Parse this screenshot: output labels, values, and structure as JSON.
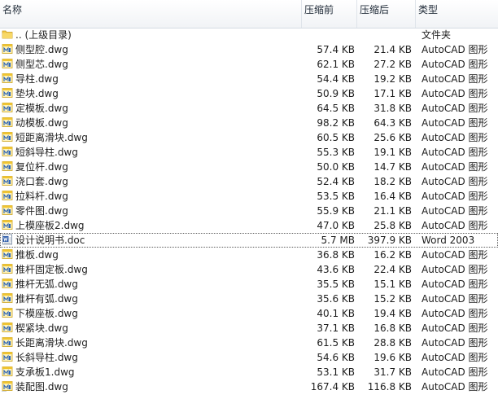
{
  "columns": {
    "name": "名称",
    "before": "压缩前",
    "after": "压缩后",
    "type": "类型"
  },
  "files": [
    {
      "name": ".. (上级目录)",
      "before": "",
      "after": "",
      "type": "文件夹",
      "icon": "folder-icon"
    },
    {
      "name": "侧型腔.dwg",
      "before": "57.4 KB",
      "after": "21.4 KB",
      "type": "AutoCAD 图形",
      "icon": "dwg-file-icon"
    },
    {
      "name": "侧型芯.dwg",
      "before": "62.1 KB",
      "after": "27.2 KB",
      "type": "AutoCAD 图形",
      "icon": "dwg-file-icon"
    },
    {
      "name": "导柱.dwg",
      "before": "54.4 KB",
      "after": "19.2 KB",
      "type": "AutoCAD 图形",
      "icon": "dwg-file-icon"
    },
    {
      "name": "垫块.dwg",
      "before": "50.9 KB",
      "after": "17.1 KB",
      "type": "AutoCAD 图形",
      "icon": "dwg-file-icon"
    },
    {
      "name": "定模板.dwg",
      "before": "64.5 KB",
      "after": "31.8 KB",
      "type": "AutoCAD 图形",
      "icon": "dwg-file-icon"
    },
    {
      "name": "动模板.dwg",
      "before": "98.2 KB",
      "after": "64.3 KB",
      "type": "AutoCAD 图形",
      "icon": "dwg-file-icon"
    },
    {
      "name": "短距离滑块.dwg",
      "before": "60.5 KB",
      "after": "25.6 KB",
      "type": "AutoCAD 图形",
      "icon": "dwg-file-icon"
    },
    {
      "name": "短斜导柱.dwg",
      "before": "55.3 KB",
      "after": "19.1 KB",
      "type": "AutoCAD 图形",
      "icon": "dwg-file-icon"
    },
    {
      "name": "复位杆.dwg",
      "before": "50.0 KB",
      "after": "14.7 KB",
      "type": "AutoCAD 图形",
      "icon": "dwg-file-icon"
    },
    {
      "name": "浇口套.dwg",
      "before": "52.4 KB",
      "after": "18.2 KB",
      "type": "AutoCAD 图形",
      "icon": "dwg-file-icon"
    },
    {
      "name": "拉料杆.dwg",
      "before": "53.5 KB",
      "after": "16.4 KB",
      "type": "AutoCAD 图形",
      "icon": "dwg-file-icon"
    },
    {
      "name": "零件图.dwg",
      "before": "55.9 KB",
      "after": "21.1 KB",
      "type": "AutoCAD 图形",
      "icon": "dwg-file-icon"
    },
    {
      "name": "上模座板2.dwg",
      "before": "47.0 KB",
      "after": "25.8 KB",
      "type": "AutoCAD 图形",
      "icon": "dwg-file-icon"
    },
    {
      "name": "设计说明书.doc",
      "before": "5.7 MB",
      "after": "397.9 KB",
      "type": "Word 2003",
      "icon": "word-file-icon",
      "focused": true
    },
    {
      "name": "推板.dwg",
      "before": "36.8 KB",
      "after": "16.2 KB",
      "type": "AutoCAD 图形",
      "icon": "dwg-file-icon"
    },
    {
      "name": "推杆固定板.dwg",
      "before": "43.6 KB",
      "after": "22.4 KB",
      "type": "AutoCAD 图形",
      "icon": "dwg-file-icon"
    },
    {
      "name": "推杆无弧.dwg",
      "before": "35.5 KB",
      "after": "15.1 KB",
      "type": "AutoCAD 图形",
      "icon": "dwg-file-icon"
    },
    {
      "name": "推杆有弧.dwg",
      "before": "35.6 KB",
      "after": "15.2 KB",
      "type": "AutoCAD 图形",
      "icon": "dwg-file-icon"
    },
    {
      "name": "下模座板.dwg",
      "before": "40.1 KB",
      "after": "19.4 KB",
      "type": "AutoCAD 图形",
      "icon": "dwg-file-icon"
    },
    {
      "name": "楔紧块.dwg",
      "before": "37.1 KB",
      "after": "16.8 KB",
      "type": "AutoCAD 图形",
      "icon": "dwg-file-icon"
    },
    {
      "name": "长距离滑块.dwg",
      "before": "61.5 KB",
      "after": "28.8 KB",
      "type": "AutoCAD 图形",
      "icon": "dwg-file-icon"
    },
    {
      "name": "长斜导柱.dwg",
      "before": "54.6 KB",
      "after": "19.6 KB",
      "type": "AutoCAD 图形",
      "icon": "dwg-file-icon"
    },
    {
      "name": "支承板1.dwg",
      "before": "53.1 KB",
      "after": "31.7 KB",
      "type": "AutoCAD 图形",
      "icon": "dwg-file-icon"
    },
    {
      "name": "装配图.dwg",
      "before": "167.4 KB",
      "after": "116.8 KB",
      "type": "AutoCAD 图形",
      "icon": "dwg-file-icon"
    }
  ]
}
